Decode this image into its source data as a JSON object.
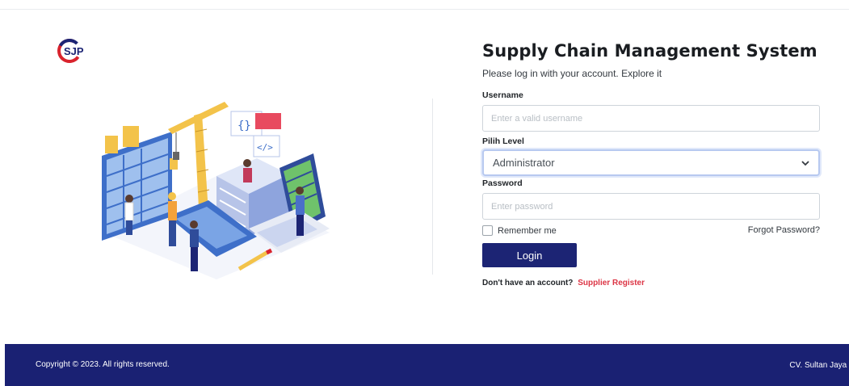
{
  "brand": {
    "logo_text": "SJP",
    "logo_color": "#1c2474",
    "logo_accent": "#d9232d"
  },
  "login": {
    "title": "Supply Chain Management System",
    "subtitle": "Please log in with your account. Explore it",
    "username_label": "Username",
    "username_placeholder": "Enter a valid username",
    "level_label": "Pilih Level",
    "level_selected": "Administrator",
    "password_label": "Password",
    "password_placeholder": "Enter password",
    "remember_label": "Remember me",
    "forgot_label": "Forgot Password?",
    "login_button": "Login",
    "register_prompt": "Don't have an account?",
    "register_link": "Supplier Register"
  },
  "footer": {
    "copyright": "Copyright © 2023. All rights reserved.",
    "company": "CV. Sultan Jaya Pertiwi"
  },
  "colors": {
    "primary": "#1c2474",
    "link": "#dc3545",
    "footer_bg": "#1a2173"
  }
}
